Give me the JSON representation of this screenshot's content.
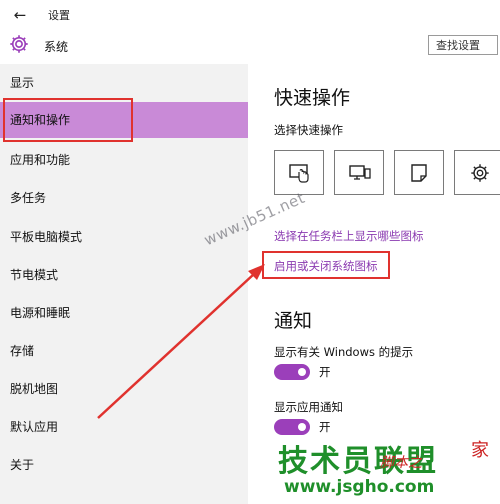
{
  "window": {
    "title": "设置",
    "back_glyph": "←"
  },
  "header": {
    "title": "系统",
    "search_placeholder": "查找设置"
  },
  "sidebar": {
    "items": [
      {
        "label": "显示"
      },
      {
        "label": "通知和操作"
      },
      {
        "label": "应用和功能"
      },
      {
        "label": "多任务"
      },
      {
        "label": "平板电脑模式"
      },
      {
        "label": "节电模式"
      },
      {
        "label": "电源和睡眠"
      },
      {
        "label": "存储"
      },
      {
        "label": "脱机地图"
      },
      {
        "label": "默认应用"
      },
      {
        "label": "关于"
      }
    ],
    "active_index": 1
  },
  "main": {
    "quick_actions_title": "快速操作",
    "quick_actions_subtitle": "选择快速操作",
    "quick_action_icons": [
      "tablet-mode-icon",
      "project-icon",
      "note-icon",
      "settings-gear-icon"
    ],
    "link_taskbar": "选择在任务栏上显示哪些图标",
    "link_system_icons": "启用或关闭系统图标",
    "notifications_title": "通知",
    "windows_tips_label": "显示有关 Windows 的提示",
    "windows_tips_state": "开",
    "app_notifications_label": "显示应用通知",
    "app_notifications_state": "开"
  },
  "watermarks": {
    "diagonal_url": "www.jb51.net",
    "brand": "技术员联盟",
    "brand_url": "www.jsgho.com",
    "deco": "脚本之",
    "deco2": "家"
  },
  "colors": {
    "accent": "#9b3fba",
    "active_nav": "#c98ad7",
    "link": "#8b3bb1",
    "annotation_red": "#e0322e",
    "brand_green": "#1f8f2a"
  }
}
